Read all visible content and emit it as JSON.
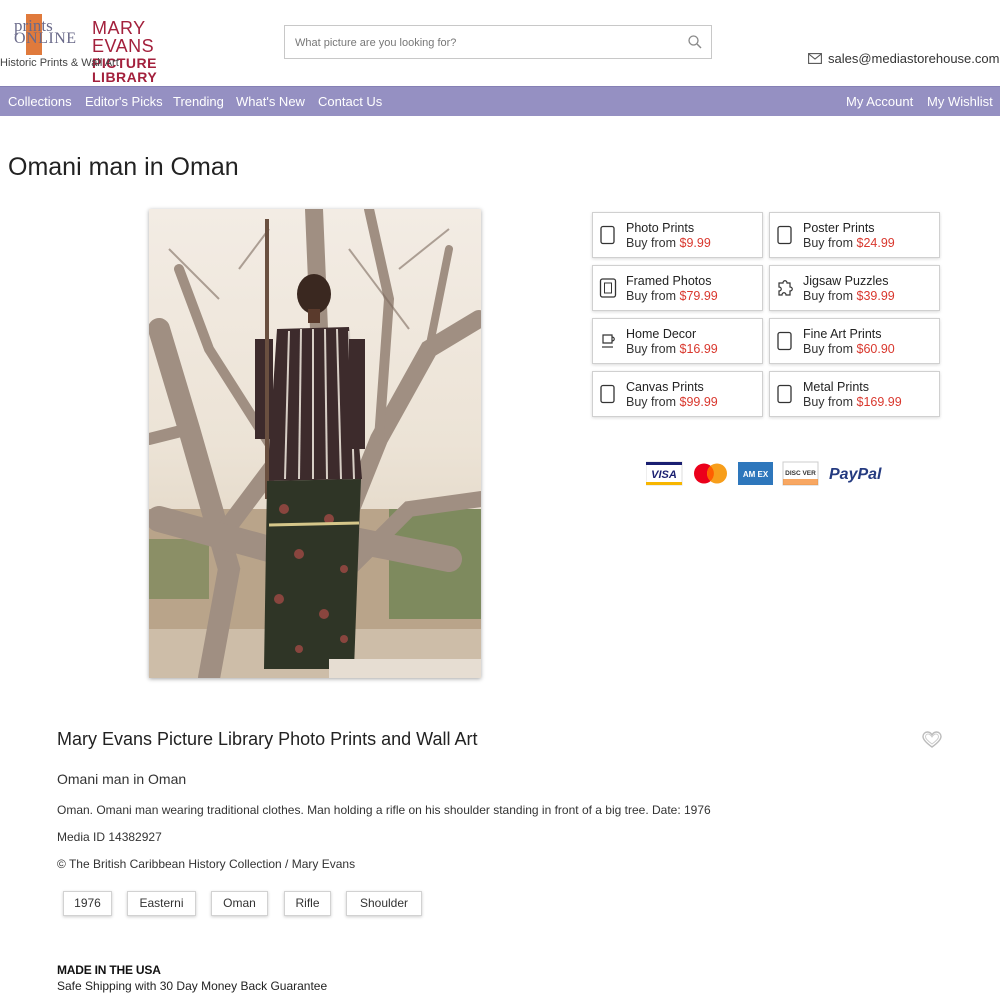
{
  "header": {
    "logo_prints_line1": "prints",
    "logo_prints_line2": "ONLINE",
    "logo_brand_line1": "MARY EVANS",
    "logo_brand_line2": "PICTURE LIBRARY",
    "tagline": "Historic Prints & Wall Art",
    "search_placeholder": "What picture are you looking for?",
    "email": "sales@mediastorehouse.com"
  },
  "nav": {
    "left": [
      "Collections",
      "Editor's Picks",
      "Trending",
      "What's New",
      "Contact Us"
    ],
    "right": [
      "My Account",
      "My Wishlist"
    ]
  },
  "page_title": "Omani man in Oman",
  "products": [
    {
      "name": "Photo Prints",
      "prefix": "Buy from ",
      "price": "$9.99",
      "icon": "photo-print-icon"
    },
    {
      "name": "Poster Prints",
      "prefix": "Buy from ",
      "price": "$24.99",
      "icon": "poster-icon"
    },
    {
      "name": "Framed Photos",
      "prefix": "Buy from ",
      "price": "$79.99",
      "icon": "frame-icon"
    },
    {
      "name": "Jigsaw Puzzles",
      "prefix": "Buy from ",
      "price": "$39.99",
      "icon": "puzzle-icon"
    },
    {
      "name": "Home Decor",
      "prefix": "Buy from ",
      "price": "$16.99",
      "icon": "mug-icon"
    },
    {
      "name": "Fine Art Prints",
      "prefix": "Buy from ",
      "price": "$60.90",
      "icon": "fine-art-icon"
    },
    {
      "name": "Canvas Prints",
      "prefix": "Buy from ",
      "price": "$99.99",
      "icon": "canvas-icon"
    },
    {
      "name": "Metal Prints",
      "prefix": "Buy from ",
      "price": "$169.99",
      "icon": "metal-icon"
    }
  ],
  "payments": {
    "visa": "VISA",
    "amex": "AM EX",
    "discover": "DISC VER",
    "paypal": "PayPal"
  },
  "info": {
    "heading": "Mary Evans Picture Library Photo Prints and Wall Art",
    "subtitle": "Omani man in Oman",
    "description": "Oman. Omani man wearing traditional clothes. Man holding a rifle on his shoulder standing in front of a big tree. Date: 1976",
    "media_id": "Media ID 14382927",
    "copyright": "© The British Caribbean History Collection / Mary Evans"
  },
  "tags": [
    "1976",
    "Easterni",
    "Oman",
    "Rifle",
    "Shoulder"
  ],
  "footer": {
    "made": "MADE IN THE USA",
    "shipping": "Safe Shipping with 30 Day Money Back Guarantee"
  },
  "colors": {
    "nav_bg": "#9590c2",
    "brand": "#a3203c",
    "price": "#d9382e",
    "logo_bar": "#e07a3c"
  }
}
